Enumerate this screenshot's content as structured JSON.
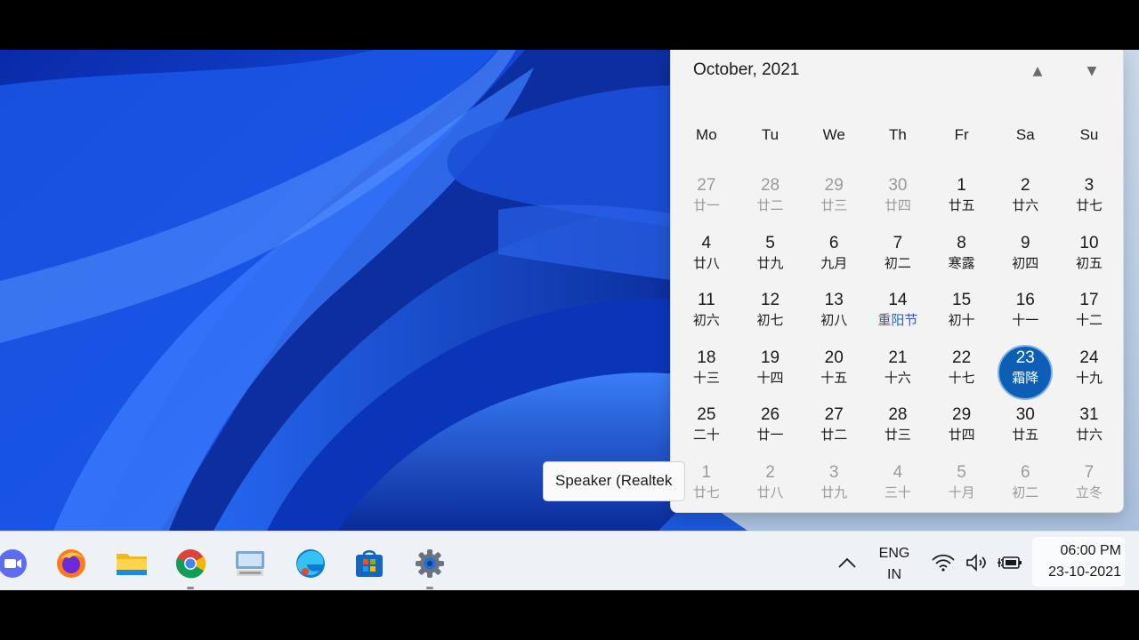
{
  "calendar": {
    "title": "October, 2021",
    "prev_icon": "chevron-up-icon",
    "next_icon": "chevron-down-icon",
    "weekdays": [
      "Mo",
      "Tu",
      "We",
      "Th",
      "Fr",
      "Sa",
      "Su"
    ],
    "days": [
      {
        "num": "27",
        "lunar": "廿一",
        "state": "other"
      },
      {
        "num": "28",
        "lunar": "廿二",
        "state": "other"
      },
      {
        "num": "29",
        "lunar": "廿三",
        "state": "other"
      },
      {
        "num": "30",
        "lunar": "廿四",
        "state": "other"
      },
      {
        "num": "1",
        "lunar": "廿五",
        "state": "current"
      },
      {
        "num": "2",
        "lunar": "廿六",
        "state": "current"
      },
      {
        "num": "3",
        "lunar": "廿七",
        "state": "current"
      },
      {
        "num": "4",
        "lunar": "廿八",
        "state": "current"
      },
      {
        "num": "5",
        "lunar": "廿九",
        "state": "current"
      },
      {
        "num": "6",
        "lunar": "九月",
        "state": "current"
      },
      {
        "num": "7",
        "lunar": "初二",
        "state": "current"
      },
      {
        "num": "8",
        "lunar": "寒露",
        "state": "current"
      },
      {
        "num": "9",
        "lunar": "初四",
        "state": "current"
      },
      {
        "num": "10",
        "lunar": "初五",
        "state": "current"
      },
      {
        "num": "11",
        "lunar": "初六",
        "state": "current"
      },
      {
        "num": "12",
        "lunar": "初七",
        "state": "current"
      },
      {
        "num": "13",
        "lunar": "初八",
        "state": "current"
      },
      {
        "num": "14",
        "lunar": "重阳节",
        "state": "festival"
      },
      {
        "num": "15",
        "lunar": "初十",
        "state": "current"
      },
      {
        "num": "16",
        "lunar": "十一",
        "state": "current"
      },
      {
        "num": "17",
        "lunar": "十二",
        "state": "current"
      },
      {
        "num": "18",
        "lunar": "十三",
        "state": "current"
      },
      {
        "num": "19",
        "lunar": "十四",
        "state": "current"
      },
      {
        "num": "20",
        "lunar": "十五",
        "state": "current"
      },
      {
        "num": "21",
        "lunar": "十六",
        "state": "current"
      },
      {
        "num": "22",
        "lunar": "十七",
        "state": "current"
      },
      {
        "num": "23",
        "lunar": "霜降",
        "state": "today"
      },
      {
        "num": "24",
        "lunar": "十九",
        "state": "current"
      },
      {
        "num": "25",
        "lunar": "二十",
        "state": "current"
      },
      {
        "num": "26",
        "lunar": "廿一",
        "state": "current"
      },
      {
        "num": "27",
        "lunar": "廿二",
        "state": "current"
      },
      {
        "num": "28",
        "lunar": "廿三",
        "state": "current"
      },
      {
        "num": "29",
        "lunar": "廿四",
        "state": "current"
      },
      {
        "num": "30",
        "lunar": "廿五",
        "state": "current"
      },
      {
        "num": "31",
        "lunar": "廿六",
        "state": "current"
      },
      {
        "num": "1",
        "lunar": "廿七",
        "state": "other"
      },
      {
        "num": "2",
        "lunar": "廿八",
        "state": "other"
      },
      {
        "num": "3",
        "lunar": "廿九",
        "state": "other"
      },
      {
        "num": "4",
        "lunar": "三十",
        "state": "other"
      },
      {
        "num": "5",
        "lunar": "十月",
        "state": "other"
      },
      {
        "num": "6",
        "lunar": "初二",
        "state": "other"
      },
      {
        "num": "7",
        "lunar": "立冬",
        "state": "other"
      }
    ]
  },
  "tooltip": {
    "text": "Speaker (Realtek"
  },
  "taskbar": {
    "apps": [
      {
        "name": "zoom-icon",
        "running": false
      },
      {
        "name": "firefox-icon",
        "running": false
      },
      {
        "name": "file-explorer-icon",
        "running": false
      },
      {
        "name": "chrome-icon",
        "running": true
      },
      {
        "name": "remote-desktop-icon",
        "running": false
      },
      {
        "name": "edge-icon",
        "running": false
      },
      {
        "name": "microsoft-store-icon",
        "running": false
      },
      {
        "name": "settings-gear-icon",
        "running": true
      }
    ],
    "tray": {
      "chevron_icon": "chevron-up-icon",
      "lang_line1": "ENG",
      "lang_line2": "IN",
      "icons": [
        "wifi-icon",
        "speaker-icon",
        "battery-charging-icon"
      ]
    },
    "clock": {
      "time": "06:00 PM",
      "date": "23-10-2021"
    }
  },
  "colors": {
    "today_bg": "#0d5fb6",
    "festival_text": "#2a62b8",
    "wallpaper_blue": "#1446d6"
  }
}
